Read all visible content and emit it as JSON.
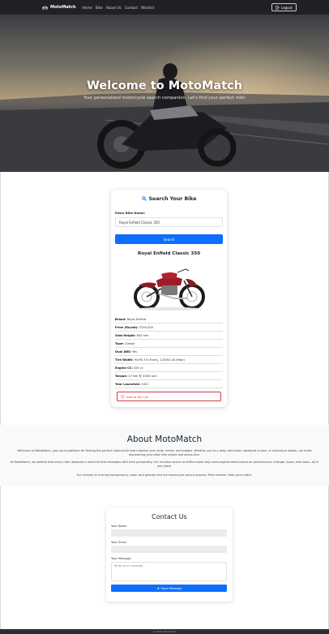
{
  "navbar": {
    "brand": "MotoMatch",
    "links": [
      "Home",
      "Bike",
      "About Us",
      "Contact",
      "Wishlist"
    ],
    "logout_label": "Logout"
  },
  "hero": {
    "title": "Welcome to MotoMatch",
    "subtitle": "Your personalized motorcycle search companion. Let's find your perfect ride!"
  },
  "search": {
    "heading": "Search Your Bike",
    "input_label": "Enter Bike Name:",
    "input_value": "Royal Enfield Classic 350",
    "button_label": "Search"
  },
  "result": {
    "title": "Royal Enfield Classic 350",
    "specs": [
      {
        "label": "Brand:",
        "value": "Royal Enfield"
      },
      {
        "label": "Price (Rs/est):",
        "value": "₹190,000"
      },
      {
        "label": "Seat Height:",
        "value": "805 mm"
      },
      {
        "label": "Type:",
        "value": "Classic"
      },
      {
        "label": "Dual ABS:",
        "value": "Yes"
      },
      {
        "label": "Tire Width:",
        "value": "90/90-19 (Front), 120/80-18 (Rear)"
      },
      {
        "label": "Engine CC:",
        "value": "349 cc"
      },
      {
        "label": "Torque:",
        "value": "27 Nm @ 4000 rpm"
      },
      {
        "label": "Year Launched:",
        "value": "2021"
      }
    ],
    "add_button_label": "Add to My List"
  },
  "about": {
    "title": "About MotoMatch",
    "paragraphs": [
      "Welcome to MotoMatch, your go-to platform for finding the perfect motorcycle that matches your style, needs, and budget. Whether you're a daily commuter, weekend cruiser, or adventure seeker, we make discovering your ideal ride simple and stress-free.",
      "At MotoMatch, we believe that every rider deserves a machine that resonates with their personality. Our intuitive search and filter tools help users explore bikes based on performance, mileage, looks, and more—all in one place.",
      "Our mission is to bring transparency, ease, and passion into the motorcycle search process. Ride smarter. Ride your match."
    ]
  },
  "contact": {
    "title": "Contact Us",
    "name_label": "Your Name",
    "email_label": "Your Email",
    "message_label": "Your Message",
    "message_placeholder": "Write your message...",
    "send_label": "Send Message"
  },
  "footer": {
    "text": "© 2025 MotoMatch"
  },
  "colors": {
    "primary": "#0d6efd",
    "danger": "#dc3545",
    "navbar": "#1f2124",
    "about_bg": "#f8f9fa"
  },
  "icons": {
    "brand": "motorcycle-icon",
    "logout": "logout-icon",
    "search_heading": "magnifier-icon",
    "add_list": "heart-icon",
    "send": "send-icon"
  }
}
